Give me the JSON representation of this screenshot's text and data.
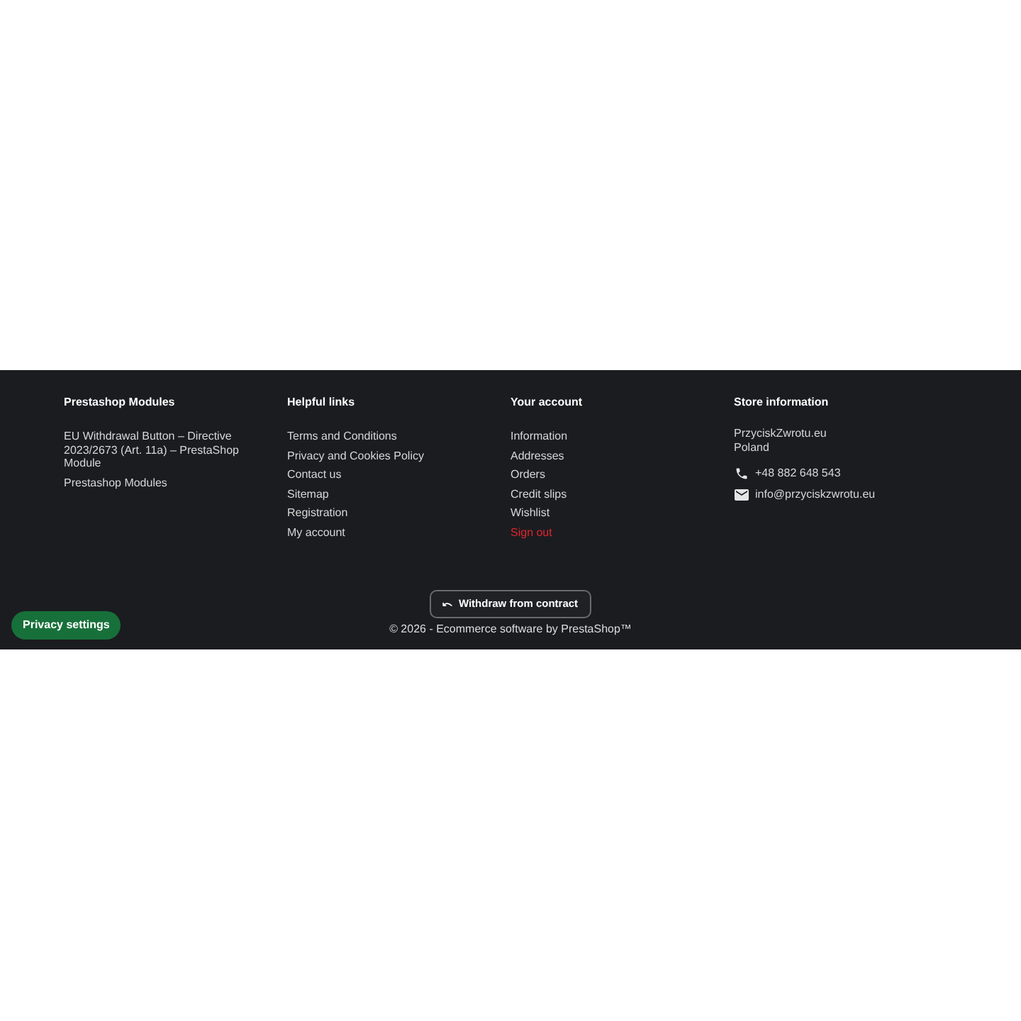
{
  "columns": [
    {
      "title": "Prestashop Modules",
      "links": [
        {
          "label": "EU Withdrawal Button – Directive 2023/2673 (Art. 11a) – PrestaShop Module",
          "kind": "link"
        },
        {
          "label": "Prestashop Modules",
          "kind": "link"
        }
      ]
    },
    {
      "title": "Helpful links",
      "links": [
        {
          "label": "Terms and Conditions",
          "kind": "link"
        },
        {
          "label": "Privacy and Cookies Policy",
          "kind": "link"
        },
        {
          "label": "Contact us",
          "kind": "link"
        },
        {
          "label": "Sitemap",
          "kind": "link"
        },
        {
          "label": "Registration",
          "kind": "link"
        },
        {
          "label": "My account",
          "kind": "link"
        }
      ]
    },
    {
      "title": "Your account",
      "links": [
        {
          "label": "Information",
          "kind": "link"
        },
        {
          "label": "Addresses",
          "kind": "link"
        },
        {
          "label": "Orders",
          "kind": "link"
        },
        {
          "label": "Credit slips",
          "kind": "link"
        },
        {
          "label": "Wishlist",
          "kind": "link"
        },
        {
          "label": "Sign out",
          "kind": "danger"
        }
      ]
    }
  ],
  "store": {
    "title": "Store information",
    "address": [
      "PrzyciskZwrotu.eu",
      "Poland"
    ],
    "contacts": [
      {
        "kind": "phone",
        "text": "+48 882 648 543"
      },
      {
        "kind": "email",
        "text": "info@przyciskzwrotu.eu"
      }
    ]
  },
  "withdraw_button": {
    "label": "Withdraw from contract"
  },
  "copyright": "© 2026 - Ecommerce software by PrestaShop™",
  "privacy_button": {
    "label": "Privacy settings"
  }
}
